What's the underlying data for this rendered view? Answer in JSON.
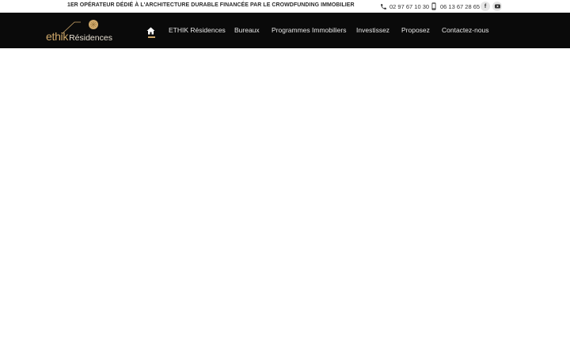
{
  "topbar": {
    "tagline": "1ER OPÉRATEUR DÉDIÉ À L'ARCHITECTURE DURABLE FINANCÉE PAR LE CROWDFUNDING IMMOBILIER",
    "phone_landline": "02 97 67 10 30",
    "phone_mobile": "06 13 67 28 65",
    "social": [
      {
        "name": "facebook",
        "glyph": "f"
      },
      {
        "name": "youtube",
        "glyph": "▶"
      }
    ]
  },
  "header": {
    "logo": {
      "word1": "ethik",
      "word2": "Résidences"
    },
    "nav": [
      {
        "label": "ETHIK Résidences"
      },
      {
        "label": "Bureaux"
      },
      {
        "label": "Programmes Immobiliers"
      },
      {
        "label": "Investissez"
      },
      {
        "label": "Proposez"
      },
      {
        "label": "Contactez-nous"
      }
    ],
    "home_icon": "home-icon",
    "active": "home"
  },
  "colors": {
    "header_bg": "#0a0a0a",
    "accent_gold": "#cfa86a",
    "nav_text": "#e6e6e6",
    "page_bg": "#ffffff"
  }
}
